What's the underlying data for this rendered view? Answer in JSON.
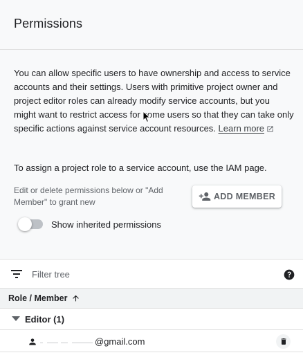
{
  "header": {
    "title": "Permissions"
  },
  "description": {
    "text": "You can allow specific users to have ownership and access to service accounts and their settings. Users with primitive project owner and project editor roles can already modify service accounts, but you might want to restrict access for some users so that they can take only specific actions against service account resources.",
    "learn_more": "Learn more"
  },
  "assign_text": "To assign a project role to a service account, use the IAM page.",
  "edit_hint": "Edit or delete permissions below or \"Add Member\" to grant new",
  "add_member_label": "ADD MEMBER",
  "inherited_toggle": {
    "label": "Show inherited permissions",
    "on": false
  },
  "filter": {
    "placeholder": "Filter tree"
  },
  "table": {
    "column_header": "Role / Member",
    "groups": [
      {
        "label": "Editor (1)",
        "members": [
          {
            "email": "@gmail.com"
          }
        ]
      }
    ]
  },
  "icons": {
    "external": "open-in-new-icon",
    "add_member": "person-add-icon",
    "filter": "filter-list-icon",
    "help": "help-icon",
    "sort": "arrow-up-icon",
    "expand": "caret-down-icon",
    "member": "person-icon",
    "delete": "trash-icon"
  },
  "colors": {
    "background": "#f8f9fa",
    "panel": "#ffffff",
    "text": "#202124",
    "muted": "#5f6368",
    "divider": "#e0e0e0"
  }
}
